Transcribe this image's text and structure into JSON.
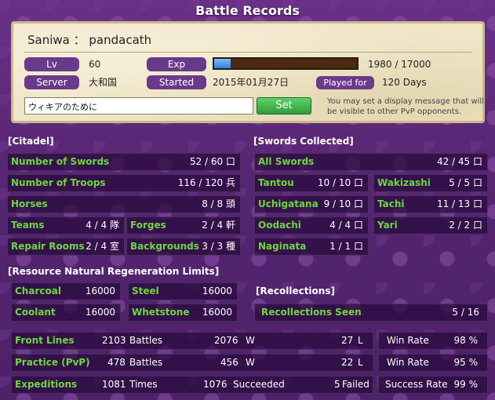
{
  "title": "Battle Records",
  "profile": {
    "name": "Saniwa ： pandacath",
    "lv_label": "Lv",
    "lv": "60",
    "exp_label": "Exp",
    "exp": "1980 / 17000",
    "exp_progress": 0.1165,
    "server_label": "Server",
    "server": "大和国",
    "started_label": "Started",
    "started": "2015年01月27日",
    "played_label": "Played for",
    "played": "120 Days",
    "message": "ウィキアのために",
    "set_label": "Set",
    "note": "You may set a display message that will be visible to other PvP opponents."
  },
  "citadel": {
    "header": "[Citadel]",
    "swords": {
      "label": "Number of Swords",
      "value": "52 / 60 口"
    },
    "troops": {
      "label": "Number of Troops",
      "value": "116 / 120 兵"
    },
    "horses": {
      "label": "Horses",
      "value": "8 / 8 頭"
    },
    "teams": {
      "label": "Teams",
      "value": "4 / 4 隊"
    },
    "forges": {
      "label": "Forges",
      "value": "2 / 4 軒"
    },
    "repair": {
      "label": "Repair Rooms",
      "value": "2 / 4 室"
    },
    "backgrounds": {
      "label": "Backgrounds",
      "value": "3 / 3 種"
    }
  },
  "swords": {
    "header": "[Swords Collected]",
    "all": {
      "label": "All Swords",
      "value": "42 / 45 口"
    },
    "tantou": {
      "label": "Tantou",
      "value": "10 / 10 口"
    },
    "wakizashi": {
      "label": "Wakizashi",
      "value": "5 / 5 口"
    },
    "uchigatana": {
      "label": "Uchigatana",
      "value": "9 / 10 口"
    },
    "tachi": {
      "label": "Tachi",
      "value": "11 / 13 口"
    },
    "oodachi": {
      "label": "Oodachi",
      "value": "4 / 4 口"
    },
    "yari": {
      "label": "Yari",
      "value": "2 / 2 口"
    },
    "naginata": {
      "label": "Naginata",
      "value": "1 / 1 口"
    }
  },
  "resources": {
    "header": "[Resource Natural Regeneration Limits]",
    "charcoal": {
      "label": "Charcoal",
      "value": "16000"
    },
    "steel": {
      "label": "Steel",
      "value": "16000"
    },
    "coolant": {
      "label": "Coolant",
      "value": "16000"
    },
    "whetstone": {
      "label": "Whetstone",
      "value": "16000"
    }
  },
  "recollections": {
    "header": "[Recollections]",
    "label": "Recollections Seen",
    "value": "5 / 16"
  },
  "battles": [
    {
      "label": "Front Lines",
      "count": "2103",
      "count_unit": "Battles",
      "won": "2076",
      "won_unit": "W",
      "lost": "27",
      "lost_unit": "L",
      "rate_label": "Win Rate",
      "rate": "98 %"
    },
    {
      "label": "Practice (PvP)",
      "count": "478",
      "count_unit": "Battles",
      "won": "456",
      "won_unit": "W",
      "lost": "22",
      "lost_unit": "L",
      "rate_label": "Win Rate",
      "rate": "95 %"
    },
    {
      "label": "Expeditions",
      "count": "1081",
      "count_unit": "Times",
      "won": "1076",
      "won_unit": "Succeeded",
      "lost": "5",
      "lost_unit": "Failed",
      "rate_label": "Success Rate",
      "rate": "99 %"
    }
  ]
}
